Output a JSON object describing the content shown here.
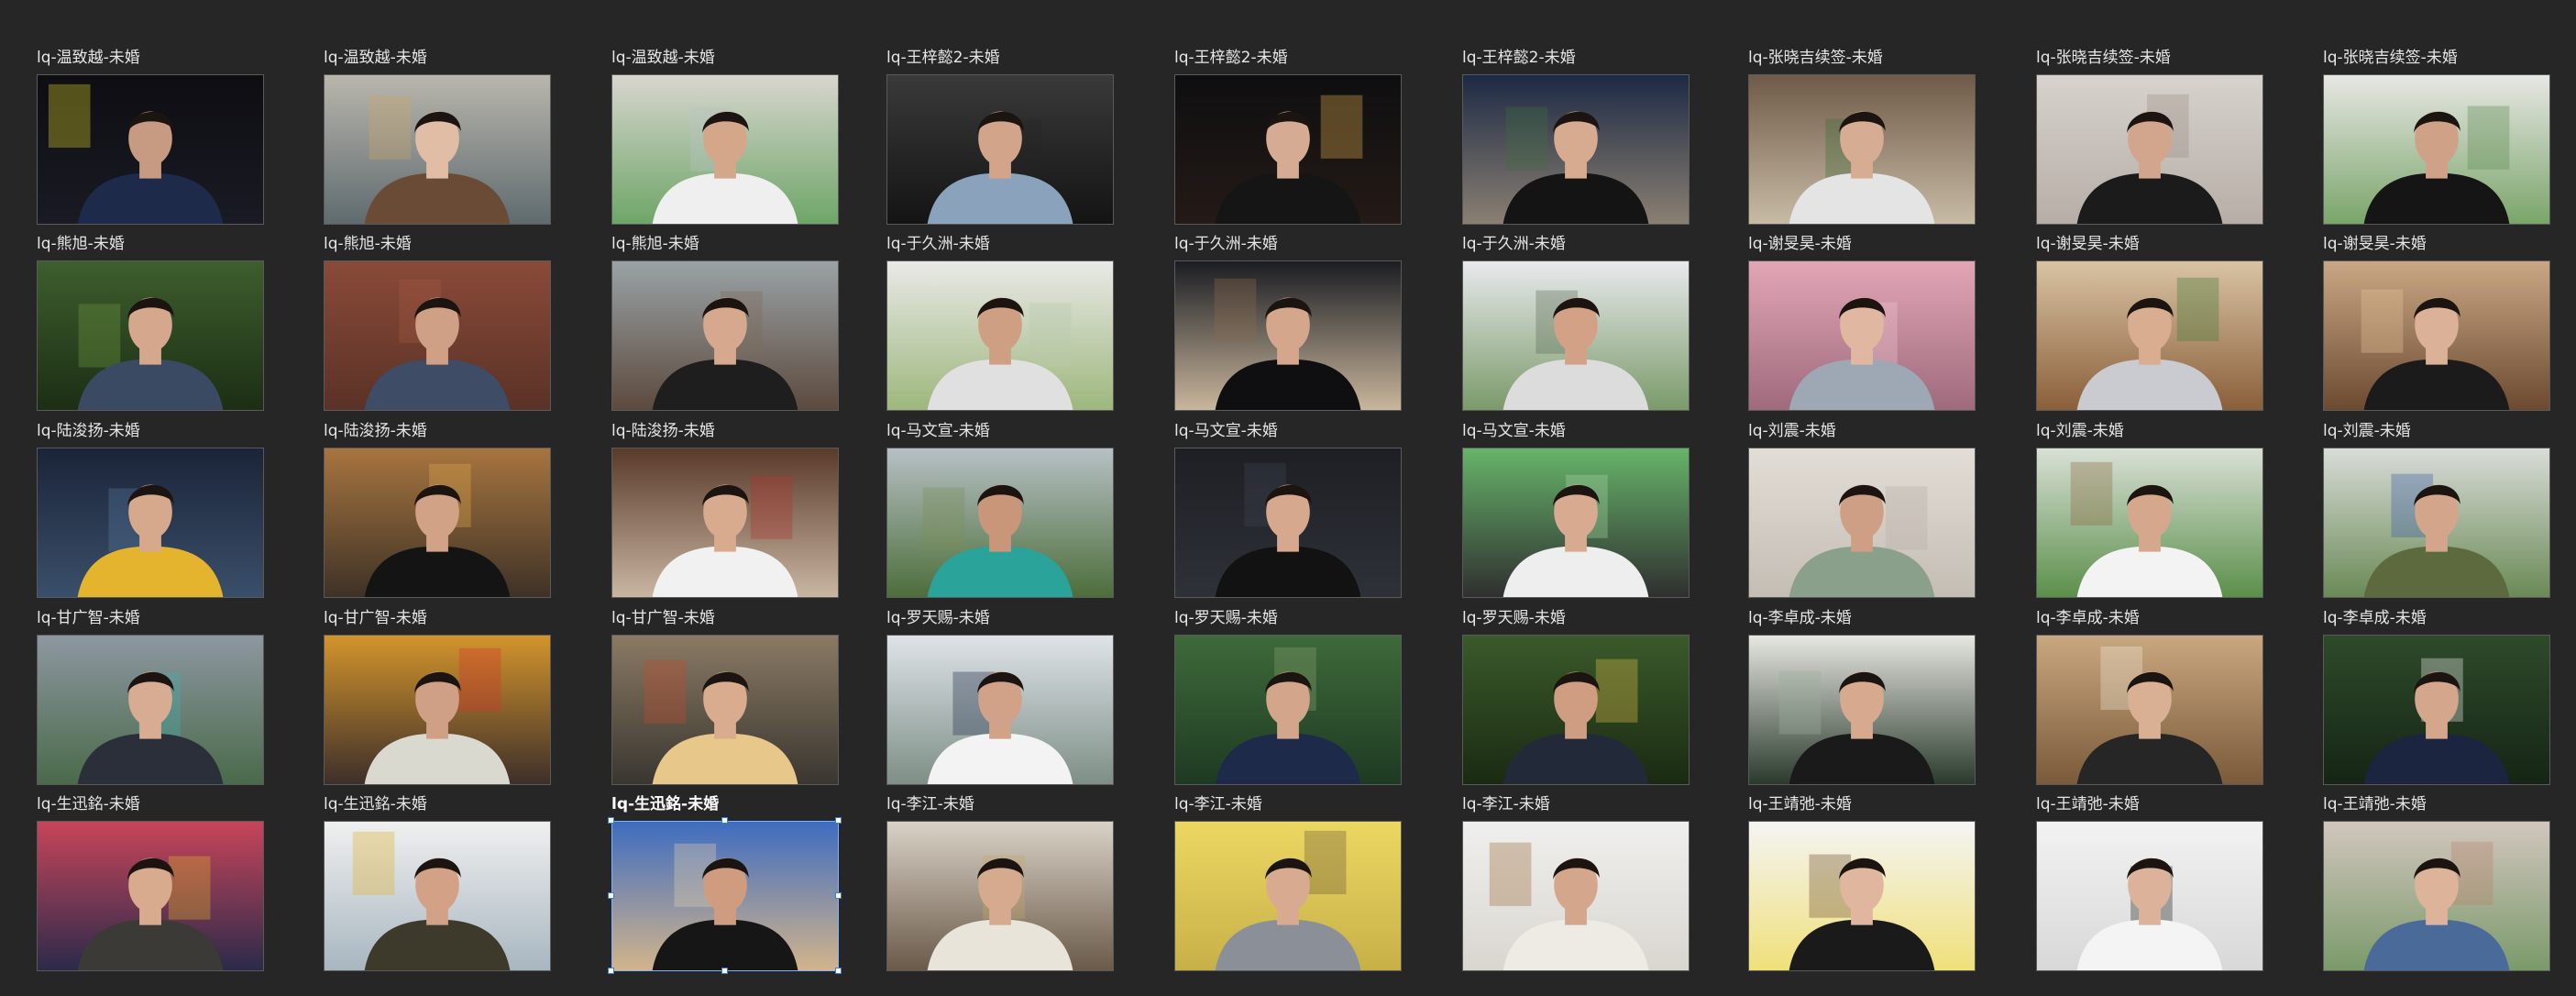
{
  "grid": {
    "columns": 9,
    "selected_index": 38,
    "items": [
      {
        "caption": "lq-温致越-未婚",
        "bg": [
          "#0d0d12",
          "#1a1a24"
        ],
        "skin": "#c79a82",
        "shirt": "#1d2a4a",
        "accent": "#d9d12b"
      },
      {
        "caption": "lq-温致越-未婚",
        "bg": [
          "#b9b6ad",
          "#5f6b6f"
        ],
        "skin": "#e2bda6",
        "shirt": "#6a4c36",
        "accent": "#caa56a"
      },
      {
        "caption": "lq-温致越-未婚",
        "bg": [
          "#d8d6cf",
          "#6ea567"
        ],
        "skin": "#d4a68a",
        "shirt": "#efefef",
        "accent": "#b7c2c7"
      },
      {
        "caption": "lq-王梓懿2-未婚",
        "bg": [
          "#3a3939",
          "#141414"
        ],
        "skin": "#d2a489",
        "shirt": "#8aa2bb",
        "accent": "#252525"
      },
      {
        "caption": "lq-王梓懿2-未婚",
        "bg": [
          "#0e0e10",
          "#241a16"
        ],
        "skin": "#d6ab93",
        "shirt": "#151515",
        "accent": "#e0b04e"
      },
      {
        "caption": "lq-王梓懿2-未婚",
        "bg": [
          "#1d2a44",
          "#8a7f72"
        ],
        "skin": "#d7ab90",
        "shirt": "#141414",
        "accent": "#3f6e3c"
      },
      {
        "caption": "lq-张晓吉续签-未婚",
        "bg": [
          "#6f5a48",
          "#c8bba6"
        ],
        "skin": "#d6ad93",
        "shirt": "#e4e4e4",
        "accent": "#3f6e3a"
      },
      {
        "caption": "lq-张晓吉续签-未婚",
        "bg": [
          "#d7d2cd",
          "#b6aea6"
        ],
        "skin": "#d1a68c",
        "shirt": "#1b1b1b",
        "accent": "#9a8d85"
      },
      {
        "caption": "lq-张晓吉续签-未婚",
        "bg": [
          "#e7e7e4",
          "#7aa56a"
        ],
        "skin": "#cfa287",
        "shirt": "#151515",
        "accent": "#5b8a4f"
      },
      {
        "caption": "lq-熊旭-未婚",
        "bg": [
          "#3d5e2d",
          "#1c2e14"
        ],
        "skin": "#d5a78c",
        "shirt": "#3b4a63",
        "accent": "#6f9a41"
      },
      {
        "caption": "lq-熊旭-未婚",
        "bg": [
          "#8a4a39",
          "#5a3226"
        ],
        "skin": "#cfa085",
        "shirt": "#3f4c66",
        "accent": "#a35a43"
      },
      {
        "caption": "lq-熊旭-未婚",
        "bg": [
          "#9aa2a6",
          "#5c4a3d"
        ],
        "skin": "#d6a98f",
        "shirt": "#1e1e1e",
        "accent": "#7d6a5a"
      },
      {
        "caption": "lq-于久洲-未婚",
        "bg": [
          "#e9e9e7",
          "#9db77c"
        ],
        "skin": "#cf9f84",
        "shirt": "#e0e0e0",
        "accent": "#b9c9b0"
      },
      {
        "caption": "lq-于久洲-未婚",
        "bg": [
          "#1b1d22",
          "#c9b69c"
        ],
        "skin": "#d4a78d",
        "shirt": "#0f0f12",
        "accent": "#8a6a4c"
      },
      {
        "caption": "lq-于久洲-未婚",
        "bg": [
          "#e8e9ec",
          "#7b9a6a"
        ],
        "skin": "#d3a286",
        "shirt": "#dcdcdc",
        "accent": "#5c6a55"
      },
      {
        "caption": "lq-谢旻昊-未婚",
        "bg": [
          "#e2a6b6",
          "#9e6a7c"
        ],
        "skin": "#e0b8a1",
        "shirt": "#9ea8b5",
        "accent": "#f0c6d2"
      },
      {
        "caption": "lq-谢旻昊-未婚",
        "bg": [
          "#d9c3a3",
          "#8a5f3a"
        ],
        "skin": "#d9ad90",
        "shirt": "#c9cbd0",
        "accent": "#3f7a3a"
      },
      {
        "caption": "lq-谢旻昊-未婚",
        "bg": [
          "#caa784",
          "#6b4a31"
        ],
        "skin": "#dbb297",
        "shirt": "#1b1b1b",
        "accent": "#e6c59c"
      },
      {
        "caption": "lq-陆浚扬-未婚",
        "bg": [
          "#1b2438",
          "#3a4f6a"
        ],
        "skin": "#d6a98d",
        "shirt": "#e4b42f",
        "accent": "#5a7aa0"
      },
      {
        "caption": "lq-陆浚扬-未婚",
        "bg": [
          "#a7753f",
          "#3e3226"
        ],
        "skin": "#d2a287",
        "shirt": "#141414",
        "accent": "#e0a84c"
      },
      {
        "caption": "lq-陆浚扬-未婚",
        "bg": [
          "#5a3a2a",
          "#c9b6a2"
        ],
        "skin": "#d8ab8f",
        "shirt": "#f1f1f1",
        "accent": "#b0342c"
      },
      {
        "caption": "lq-马文宣-未婚",
        "bg": [
          "#b7c0c5",
          "#4c6e3a"
        ],
        "skin": "#c99679",
        "shirt": "#2aa39a",
        "accent": "#7a8f55"
      },
      {
        "caption": "lq-马文宣-未婚",
        "bg": [
          "#1d1f24",
          "#2e3138"
        ],
        "skin": "#d6a98e",
        "shirt": "#121212",
        "accent": "#3e4450"
      },
      {
        "caption": "lq-马文宣-未婚",
        "bg": [
          "#66b46a",
          "#2f2f2f"
        ],
        "skin": "#d8ab90",
        "shirt": "#eeeeee",
        "accent": "#a7d7a2"
      },
      {
        "caption": "lq-刘震-未婚",
        "bg": [
          "#e2ddd6",
          "#c4bdb4"
        ],
        "skin": "#cf9f85",
        "shirt": "#8aa08a",
        "accent": "#b8afa5"
      },
      {
        "caption": "lq-刘震-未婚",
        "bg": [
          "#d9e0d6",
          "#5b8f4a"
        ],
        "skin": "#d5a88d",
        "shirt": "#f3f3f3",
        "accent": "#8c6a42"
      },
      {
        "caption": "lq-刘震-未婚",
        "bg": [
          "#d9dcd8",
          "#6a8a56"
        ],
        "skin": "#d3a58a",
        "shirt": "#5c6a3e",
        "accent": "#3a5ba8"
      },
      {
        "caption": "lq-甘广智-未婚",
        "bg": [
          "#8d97a0",
          "#4a6a4a"
        ],
        "skin": "#d8ac92",
        "shirt": "#2a2f3a",
        "accent": "#3fb0b0"
      },
      {
        "caption": "lq-甘广智-未婚",
        "bg": [
          "#d3942c",
          "#3d2f2a"
        ],
        "skin": "#d0a086",
        "shirt": "#d9d9d0",
        "accent": "#d7342c"
      },
      {
        "caption": "lq-甘广智-未婚",
        "bg": [
          "#8a7a64",
          "#3a3630"
        ],
        "skin": "#d9ab8f",
        "shirt": "#e7c88a",
        "accent": "#c44a2c"
      },
      {
        "caption": "lq-罗天赐-未婚",
        "bg": [
          "#dfe3e8",
          "#7d8f86"
        ],
        "skin": "#d1a287",
        "shirt": "#f3f3f3",
        "accent": "#1d2a4a"
      },
      {
        "caption": "lq-罗天赐-未婚",
        "bg": [
          "#3e6a3a",
          "#1e3a22"
        ],
        "skin": "#d3a58a",
        "shirt": "#1d2a4a",
        "accent": "#8aa070"
      },
      {
        "caption": "lq-罗天赐-未婚",
        "bg": [
          "#3a5a2a",
          "#1a2a12"
        ],
        "skin": "#cf9e82",
        "shirt": "#222a3a",
        "accent": "#e3c04a"
      },
      {
        "caption": "lq-李卓成-未婚",
        "bg": [
          "#e7e7e2",
          "#2a3a2c"
        ],
        "skin": "#d7aa8f",
        "shirt": "#1a1a1a",
        "accent": "#9ab09a"
      },
      {
        "caption": "lq-李卓成-未婚",
        "bg": [
          "#c9a780",
          "#7a5a3a"
        ],
        "skin": "#dab094",
        "shirt": "#262626",
        "accent": "#f0e7d8"
      },
      {
        "caption": "lq-李卓成-未婚",
        "bg": [
          "#2e4a2a",
          "#152515"
        ],
        "skin": "#d4a78c",
        "shirt": "#1b2540",
        "accent": "#f2f2f2"
      },
      {
        "caption": "lq-生迅銘-未婚",
        "bg": [
          "#c7455a",
          "#2b2a4a"
        ],
        "skin": "#d8aa8e",
        "shirt": "#3c3a36",
        "accent": "#e3b52c"
      },
      {
        "caption": "lq-生迅銘-未婚",
        "bg": [
          "#f0f0f0",
          "#a8b6c0"
        ],
        "skin": "#d3a286",
        "shirt": "#3d3a2c",
        "accent": "#e0b22a"
      },
      {
        "caption": "lq-生迅銘-未婚",
        "bg": [
          "#3e6cc0",
          "#d2b48c"
        ],
        "skin": "#cf9c80",
        "shirt": "#161616",
        "accent": "#e6d2b0"
      },
      {
        "caption": "lq-李江-未婚",
        "bg": [
          "#d9d2c6",
          "#6a5a4a"
        ],
        "skin": "#d6aa8f",
        "shirt": "#e9e4da",
        "accent": "#c9a76a"
      },
      {
        "caption": "lq-李江-未婚",
        "bg": [
          "#ecd762",
          "#c8b048"
        ],
        "skin": "#d8ab90",
        "shirt": "#8a8f98",
        "accent": "#6a5a3a"
      },
      {
        "caption": "lq-李江-未婚",
        "bg": [
          "#efefed",
          "#d9d6d0"
        ],
        "skin": "#d4a78d",
        "shirt": "#eeeae4",
        "accent": "#9a6a3a"
      },
      {
        "caption": "lq-王靖弛-未婚",
        "bg": [
          "#f4f4f4",
          "#f0e07a"
        ],
        "skin": "#e0b79e",
        "shirt": "#1a1a1a",
        "accent": "#6a4a2a"
      },
      {
        "caption": "lq-王靖弛-未婚",
        "bg": [
          "#f2f2f2",
          "#d8d8d8"
        ],
        "skin": "#dcb39a",
        "shirt": "#f4f4f4",
        "accent": "#1a1a1a"
      },
      {
        "caption": "lq-王靖弛-未婚",
        "bg": [
          "#d2c6be",
          "#7a9a6a"
        ],
        "skin": "#ddb49a",
        "shirt": "#4a6a9a",
        "accent": "#b9826a"
      }
    ]
  }
}
